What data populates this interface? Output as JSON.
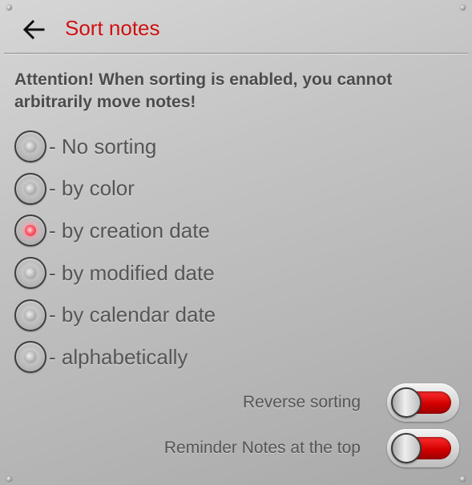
{
  "header": {
    "title": "Sort notes",
    "back_icon": "arrow-left-icon"
  },
  "warning": "Attention! When sorting is enabled, you cannot arbitrarily move notes!",
  "sort_options": {
    "items": [
      {
        "label": "- No sorting",
        "selected": false
      },
      {
        "label": "- by color",
        "selected": false
      },
      {
        "label": "- by creation date",
        "selected": true
      },
      {
        "label": "- by modified date",
        "selected": false
      },
      {
        "label": "- by calendar date",
        "selected": false
      },
      {
        "label": "- alphabetically",
        "selected": false
      }
    ],
    "selected_led_color": "#ff4d5e"
  },
  "toggles": {
    "reverse_sorting": {
      "label": "Reverse sorting",
      "on": false
    },
    "reminder_top": {
      "label": "Reminder Notes at the top",
      "on": false
    }
  },
  "colors": {
    "accent": "#cc1010",
    "switch_track": "#d40000"
  }
}
